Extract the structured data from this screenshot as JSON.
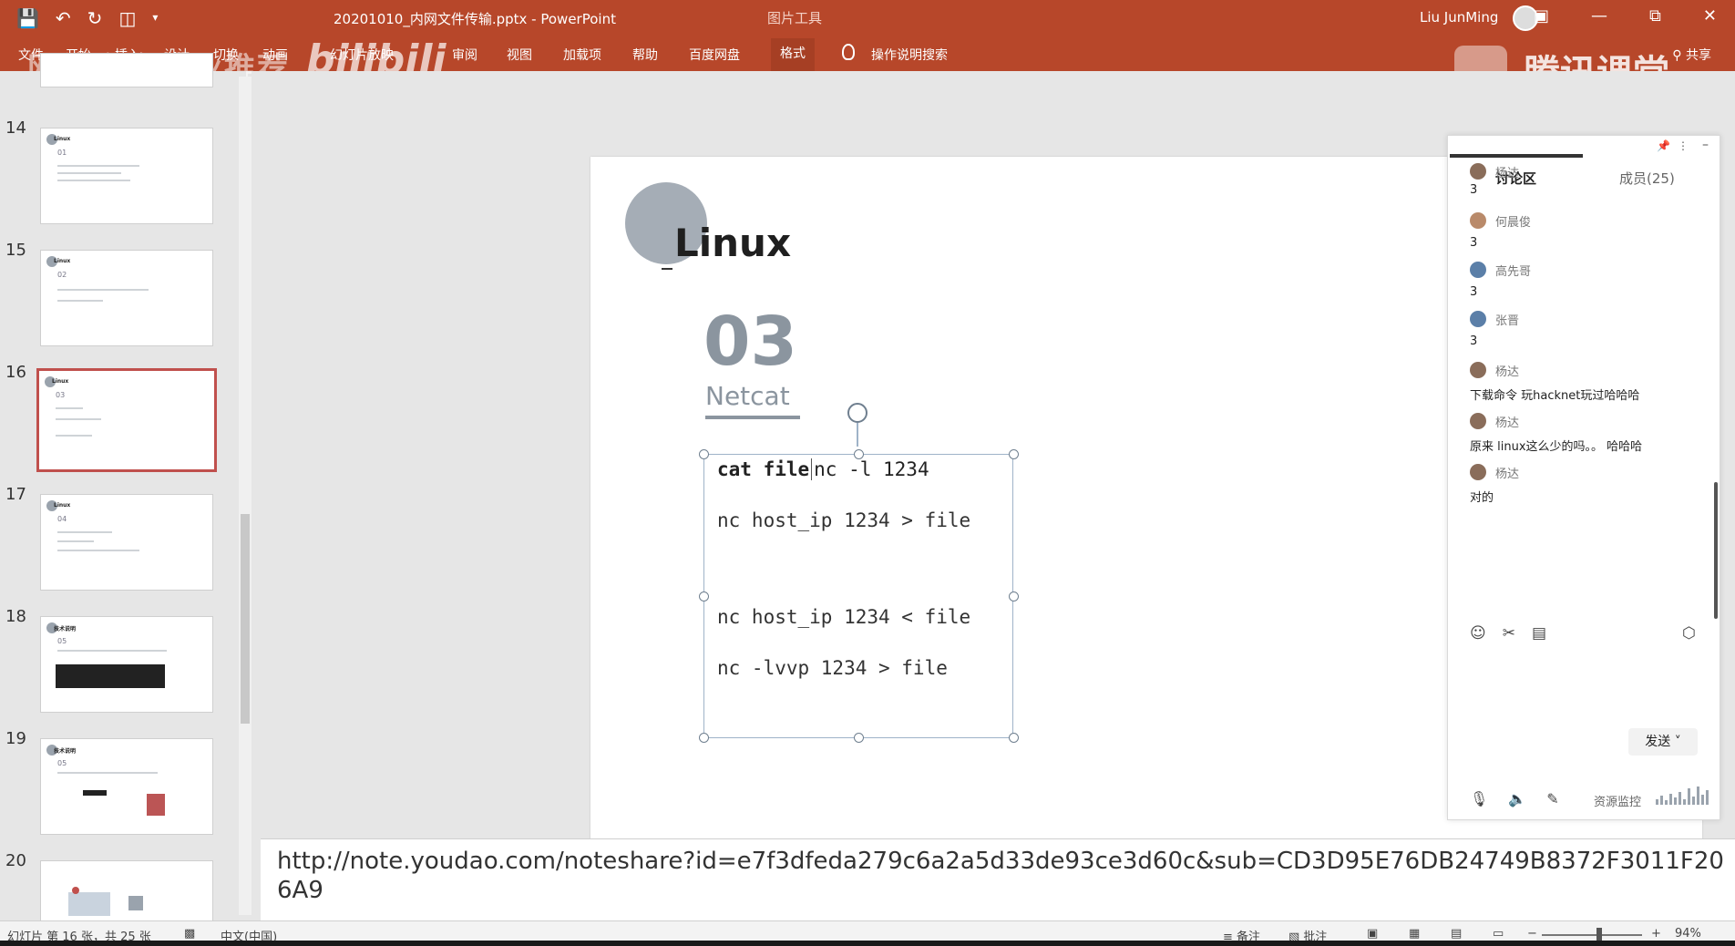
{
  "titlebar": {
    "save_icon": "save-icon",
    "undo_icon": "undo-icon",
    "redo_icon": "repeat-icon",
    "present_icon": "present-from-start-icon",
    "customize_icon": "customize-qat-icon",
    "filename": "20201010_内网文件传输.pptx - PowerPoint",
    "contextual_label": "图片工具",
    "user_name": "Liu JunMing",
    "ribbon_display_icon": "ribbon-display-icon",
    "minimize_icon": "minimize-icon",
    "restore_icon": "restore-icon",
    "close_icon": "close-icon"
  },
  "ribbon": {
    "tabs": [
      "文件",
      "开始",
      "插入",
      "设计",
      "切换",
      "动画",
      "幻灯片放映",
      "审阅",
      "视图",
      "加载项",
      "帮助",
      "百度网盘",
      "格式"
    ],
    "active_tab": "格式",
    "search_label": "操作说明搜索",
    "share_label": "共享"
  },
  "watermarks": {
    "left": "网络安全就业推荐",
    "bili": "bilibili",
    "right": "腾讯课堂"
  },
  "thumbnails": {
    "slides": [
      {
        "number": "14",
        "title": "Linux",
        "sub": "01"
      },
      {
        "number": "15",
        "title": "Linux",
        "sub": "02"
      },
      {
        "number": "16",
        "title": "Linux",
        "sub": "03"
      },
      {
        "number": "17",
        "title": "Linux",
        "sub": "04"
      },
      {
        "number": "18",
        "title": "技术说明",
        "sub": "05"
      },
      {
        "number": "19",
        "title": "技术说明",
        "sub": "05"
      },
      {
        "number": "20",
        "title": "",
        "sub": ""
      }
    ],
    "selected_index": 2
  },
  "slide": {
    "heading": "Linux",
    "section_number": "03",
    "section_title": "Netcat",
    "code": [
      {
        "before": "cat file",
        "after": "nc -l 1234"
      },
      "nc host_ip 1234 > file",
      "nc host_ip 1234 < file",
      "nc -lvvp 1234 > file"
    ]
  },
  "chat": {
    "tab_discussion": "讨论区",
    "tab_members": "成员(25)",
    "messages": [
      {
        "name": "杨达",
        "text": "3",
        "avatar_color": "#8a6d5a"
      },
      {
        "name": "何晨俊",
        "text": "3",
        "avatar_color": "#b98a6a"
      },
      {
        "name": "高先哥",
        "text": "3",
        "avatar_color": "#5b7fa8"
      },
      {
        "name": "张晋",
        "text": "3",
        "avatar_color": "#5b7fa8"
      },
      {
        "name": "杨达",
        "text": "下载命令 玩hacknet玩过哈哈哈",
        "avatar_color": "#8a6d5a"
      },
      {
        "name": "杨达",
        "text": "原来 linux这么少的吗。。 哈哈哈",
        "avatar_color": "#8a6d5a"
      },
      {
        "name": "杨达",
        "text": "对的",
        "avatar_color": "#8a6d5a"
      }
    ],
    "emoji_icon": "emoji-icon",
    "scissors_icon": "scissors-icon",
    "image_icon": "image-icon",
    "settings_icon": "settings-icon",
    "send_label": "发送",
    "mic_icon": "microphone-icon",
    "speaker_icon": "speaker-icon",
    "pen_icon": "pen-icon",
    "resource_label": "资源监控"
  },
  "notes": {
    "text": "http://note.youdao.com/noteshare?id=e7f3dfeda279c6a2a5d33de93ce3d60c&sub=CD3D95E76DB24749B8372F3011F206A9"
  },
  "status": {
    "slide_info": "幻灯片 第 16 张，共 25 张",
    "language": "中文(中国)",
    "notes_label": "备注",
    "comments_label": "批注",
    "zoom": "94%"
  }
}
